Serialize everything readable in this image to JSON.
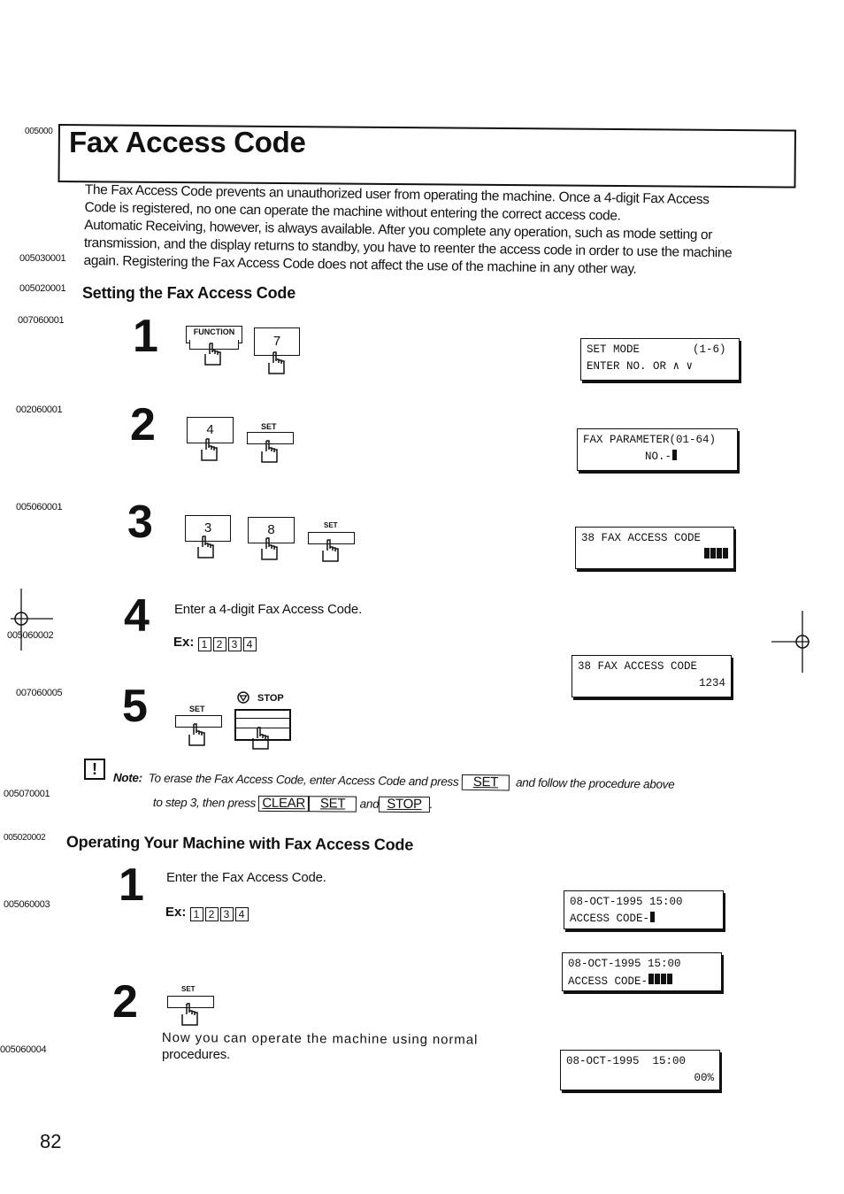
{
  "page": {
    "title": "Fax Access Code",
    "title_code": "005000",
    "intro_code": "005030001",
    "intro_lines": [
      "The Fax Access Code prevents an unauthorized user from operating the machine.  Once a 4-digit Fax Access",
      "Code is registered, no one can operate the machine without entering the correct access code.",
      "Automatic Receiving, however, is always available.  After you complete any operation, such as mode setting or",
      "transmission, and the display returns to standby, you have to reenter the access code in order to use the machine",
      "again.  Registering the Fax Access Code does not affect the use of the machine in any other way."
    ],
    "page_number": "82"
  },
  "setting": {
    "code": "005020001",
    "heading": "Setting the Fax Access Code",
    "steps": [
      {
        "num": "1",
        "code": "007060001",
        "keys": [
          {
            "label": "FUNCTION",
            "type": "function"
          },
          {
            "label": "7",
            "type": "digit"
          }
        ],
        "lcd": {
          "line1": "SET MODE        (1-6)",
          "line2": "ENTER NO. OR ∧ ∨"
        }
      },
      {
        "num": "2",
        "code": "002060001",
        "keys": [
          {
            "label": "4",
            "type": "digit"
          },
          {
            "label": "SET",
            "type": "set"
          }
        ],
        "lcd": {
          "line1": "FAX PARAMETER(01-64)",
          "line2": "NO.-"
        }
      },
      {
        "num": "3",
        "code": "005060001",
        "keys": [
          {
            "label": "3",
            "type": "digit"
          },
          {
            "label": "8",
            "type": "digit"
          },
          {
            "label": "SET",
            "type": "set"
          }
        ],
        "lcd": {
          "line1": "38 FAX ACCESS CODE",
          "line2": ""
        }
      },
      {
        "num": "4",
        "code": "005060002",
        "text": "Enter a 4-digit Fax Access Code.",
        "ex_label": "Ex:",
        "ex_digits": [
          "1",
          "2",
          "3",
          "4"
        ],
        "lcd": {
          "line1": "38 FAX ACCESS CODE",
          "line2": "1234"
        }
      },
      {
        "num": "5",
        "code": "007060005",
        "keys": [
          {
            "label": "SET",
            "type": "set"
          },
          {
            "label": "STOP",
            "type": "stop"
          }
        ]
      }
    ],
    "note": {
      "code": "005070001",
      "label": "Note:",
      "text_a": "To erase the Fax Access Code, enter Access Code and press",
      "key_set": "SET",
      "text_b": "and follow the procedure above",
      "text_c": "to step 3, then press",
      "key_clear": "CLEAR",
      "key_set2": "SET",
      "text_d": "and",
      "key_stop": "STOP",
      "text_e": "."
    }
  },
  "operating": {
    "code": "005020002",
    "heading": "Operating Your Machine with Fax Access Code",
    "steps": [
      {
        "num": "1",
        "code": "005060003",
        "text": "Enter the Fax Access Code.",
        "ex_label": "Ex:",
        "ex_digits": [
          "1",
          "2",
          "3",
          "4"
        ],
        "lcd_a": {
          "line1": "08-OCT-1995 15:00",
          "line2": "ACCESS CODE-"
        },
        "lcd_b": {
          "line1": "08-OCT-1995 15:00",
          "line2": "ACCESS CODE-"
        }
      },
      {
        "num": "2",
        "code": "005060004",
        "key": "SET",
        "text_1": "Now you can operate the machine using normal",
        "text_2": "procedures.",
        "lcd": {
          "line1": "08-OCT-1995  15:00",
          "line2": "00%"
        }
      }
    ]
  }
}
